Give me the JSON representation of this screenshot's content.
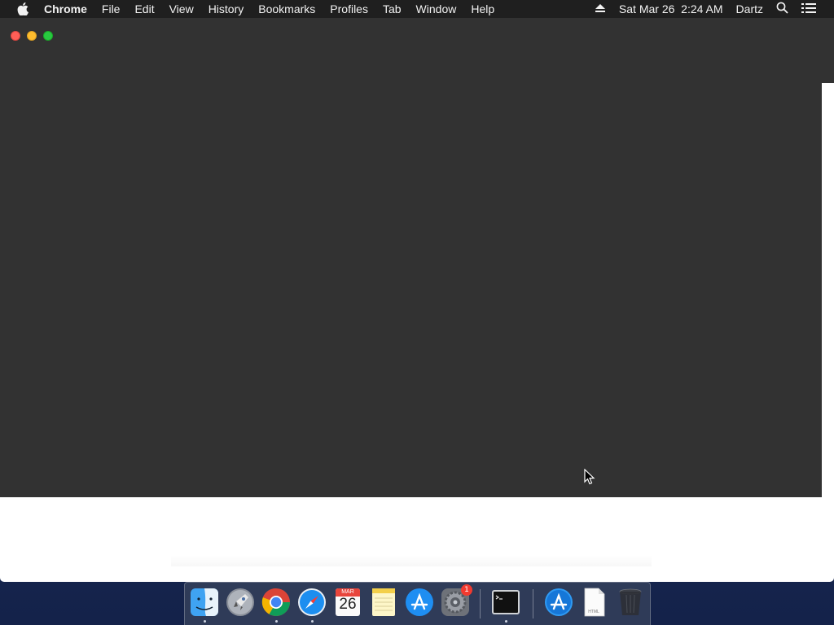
{
  "menubar": {
    "app_name": "Chrome",
    "items": [
      "File",
      "Edit",
      "View",
      "History",
      "Bookmarks",
      "Profiles",
      "Tab",
      "Window",
      "Help"
    ],
    "datetime": "Sat Mar 26  2:24 AM",
    "user": "Dartz",
    "icons": [
      "apple-icon",
      "eject-icon",
      "search-icon",
      "list-icon"
    ]
  },
  "window": {
    "content_bg": "#323232",
    "traffic_lights": [
      "close",
      "minimize",
      "zoom"
    ]
  },
  "dock": {
    "items": [
      {
        "name": "Finder",
        "icon": "finder-icon",
        "running": true
      },
      {
        "name": "Launchpad",
        "icon": "launchpad-icon",
        "running": false
      },
      {
        "name": "Google Chrome",
        "icon": "chrome-icon",
        "running": true
      },
      {
        "name": "Safari",
        "icon": "safari-icon",
        "running": true
      },
      {
        "name": "Calendar",
        "icon": "calendar-icon",
        "running": false,
        "month": "MAR",
        "day": "26"
      },
      {
        "name": "Notes",
        "icon": "notes-icon",
        "running": false
      },
      {
        "name": "App Store",
        "icon": "app-store-icon",
        "running": false
      },
      {
        "name": "System Preferences",
        "icon": "system-preferences-icon",
        "running": false,
        "badge": "1"
      },
      {
        "name": "Terminal",
        "icon": "terminal-icon",
        "running": true
      },
      {
        "name": "Applications",
        "icon": "app-store-folder-icon",
        "running": false
      },
      {
        "name": "HTML file",
        "icon": "html-file-icon",
        "running": false,
        "label": "HTML"
      },
      {
        "name": "Trash",
        "icon": "trash-icon",
        "running": false
      }
    ]
  }
}
